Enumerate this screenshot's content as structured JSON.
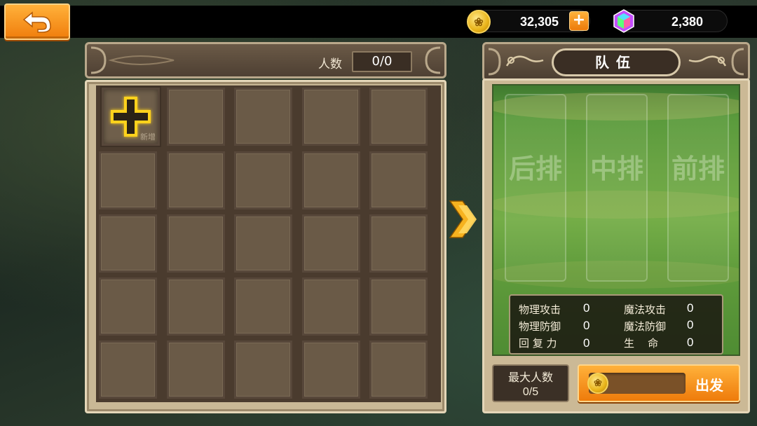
{
  "topbar": {
    "gold_value": "32,305",
    "gem_value": "2,380",
    "plus_label": "+",
    "coin_symbol": "❀",
    "gold_color": "#f0b72a",
    "back_button_color": "#f59a20"
  },
  "inventory": {
    "count_label": "人数",
    "count_value": "0/0",
    "add_slot_label": "新增",
    "slot_count": 25
  },
  "team": {
    "title": "队伍",
    "lanes": [
      {
        "label": "后排"
      },
      {
        "label": "中排"
      },
      {
        "label": "前排"
      }
    ],
    "stats": {
      "phys_attack_label": "物理攻击",
      "phys_attack_value": "0",
      "magic_attack_label": "魔法攻击",
      "magic_attack_value": "0",
      "phys_defense_label": "物理防御",
      "phys_defense_value": "0",
      "magic_defense_label": "魔法防御",
      "magic_defense_value": "0",
      "recovery_label": "回 复 力",
      "recovery_value": "0",
      "hp_label": "生    命",
      "hp_value": "0"
    },
    "max_members_label": "最大人数",
    "max_members_value": "0/5",
    "depart_label": "出发"
  }
}
